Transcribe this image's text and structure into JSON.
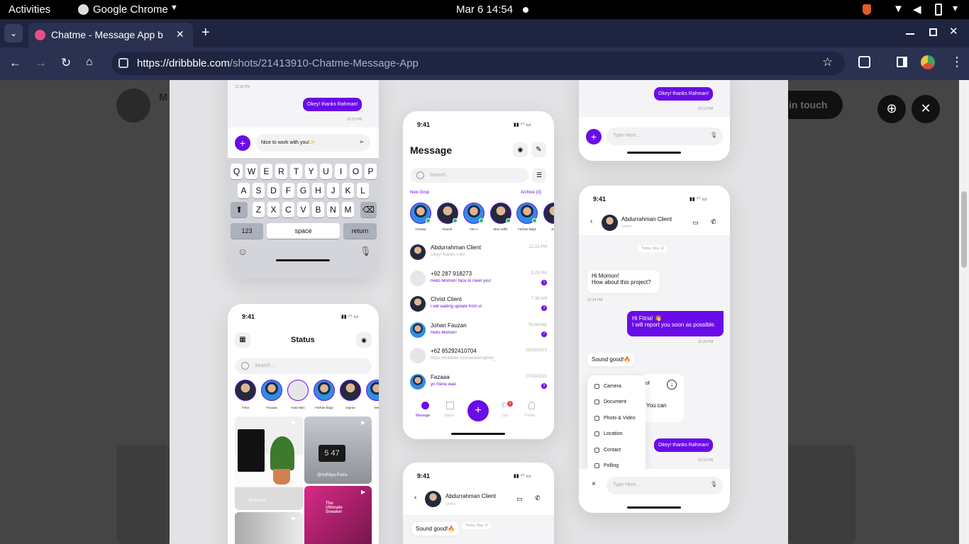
{
  "system": {
    "activities": "Activities",
    "app": "Google Chrome",
    "clock": "Mar 6  14:54"
  },
  "browser": {
    "tab_title": "Chatme - Message App b",
    "url_domain": "https://dribbble.com",
    "url_path": "/shots/21413910-Chatme-Message-App"
  },
  "dribbble": {
    "cta": "in touch",
    "initial": "M"
  },
  "phone1": {
    "time_top": "22.36 PM",
    "bubble": "Okey! thanks Rahman!",
    "time_bubble": "23.10 PM",
    "input_text": "Nice to work with you!✨",
    "row1": [
      "Q",
      "W",
      "E",
      "R",
      "T",
      "Y",
      "U",
      "I",
      "O",
      "P"
    ],
    "row2": [
      "A",
      "S",
      "D",
      "F",
      "G",
      "H",
      "J",
      "K",
      "L"
    ],
    "row3": [
      "Z",
      "X",
      "C",
      "V",
      "B",
      "N",
      "M"
    ],
    "k123": "123",
    "space": "space",
    "return": "return"
  },
  "phone2": {
    "time": "9:41",
    "title": "Status",
    "search": "Search...",
    "stories": [
      "Fitria",
      "Fazaaa",
      "Nota 8fyn",
      "Farhan Bagz",
      "Jopran",
      "Me"
    ],
    "video1_user": "@Momon",
    "video2_user": "@Adhitya Putra",
    "clock_text": "5 47",
    "video3_text": "The Ultimate Sneaker"
  },
  "phone3": {
    "time": "9:41",
    "title": "Message",
    "search": "Search...",
    "new_group": "New Grop",
    "archive": "Archive (3)",
    "stories": [
      "Fazaaa",
      "Rauult",
      "Vito A",
      "Mas Adhit",
      "Farhan Bagz",
      "Jop"
    ],
    "chats": [
      {
        "name": "Abdurrahman Client",
        "msg": "Okey! thanks Fitri!",
        "time": "12.23 PM",
        "badge": ""
      },
      {
        "name": "+92 287 918273",
        "msg": "Hello Momon! Nice to meet you!",
        "time": "9.29 PM",
        "badge": "1"
      },
      {
        "name": "Christ Client",
        "msg": "I will waiting update from u!",
        "time": "7.38 AM",
        "badge": "3"
      },
      {
        "name": "Johan Fauzan",
        "msg": "Hello Momon!",
        "time": "Yesterday",
        "badge": "7"
      },
      {
        "name": "+62 85292410704",
        "msg": "https://dribbble.com/abduirrughnii_",
        "time": "29/03/2023",
        "badge": ""
      },
      {
        "name": "Fazaaa",
        "msg": "yo mene wae",
        "time": "27/03/2023",
        "badge": "3"
      }
    ],
    "nav": [
      "Message",
      "Status",
      "Call",
      "Profile"
    ],
    "call_badge": "2"
  },
  "phone4": {
    "time": "9:41",
    "name": "Abdurrahman Client",
    "status": "Online",
    "date": "Today, May 10",
    "bubble": "Sound good!🔥"
  },
  "phone5": {
    "bubble": "Okey! thanks Rahman!",
    "time": "23.10 PM",
    "placeholder": "Type Here..."
  },
  "phone6": {
    "time": "9:41",
    "name": "Abdurrahman Client",
    "status": "Online",
    "date": "Today, May 10",
    "in1_line1": "Hi Momon!",
    "in1_line2": "How about this project?",
    "in1_time": "22.24 PM",
    "out1_line1": "Hi Fitria! 👋",
    "out1_line2": "I will report you soon as possible.",
    "out1_time": "22.29 PM",
    "in2": "Sound good!🔥",
    "hidden_a": "of",
    "hidden_b": "ole. You can",
    "menu": [
      "Camera",
      "Document",
      "Photo & Video",
      "Location",
      "Contact",
      "Polling"
    ],
    "out2": "Okey! thanks Rahman!",
    "out2_time": "23.10 PM",
    "placeholder": "Type Here..."
  },
  "colors": {
    "accent": "#6a0ce8",
    "online": "#1ec25b",
    "tabbar": "#1f2440",
    "addrbar": "#2b3150"
  }
}
